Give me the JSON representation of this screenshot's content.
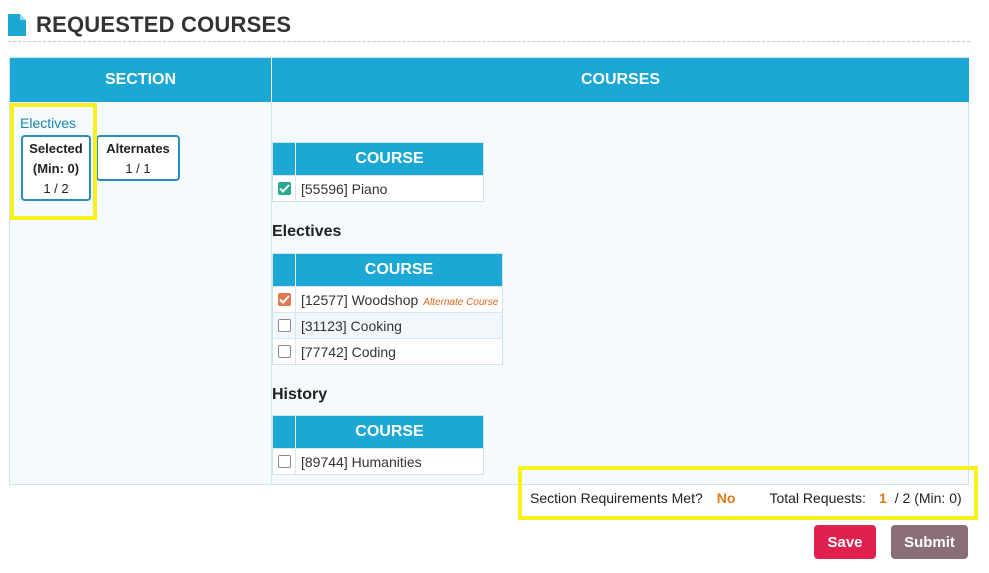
{
  "page": {
    "title": "REQUESTED COURSES"
  },
  "table": {
    "section_header": "SECTION",
    "courses_header": "COURSES"
  },
  "section_panel": {
    "link": "Electives",
    "selected": {
      "label_line1": "Selected",
      "label_line2": "(Min: 0)",
      "value": "1 / 2"
    },
    "alternates": {
      "label": "Alternates",
      "value": "1 / 1"
    }
  },
  "groups": [
    {
      "title": "",
      "column_header": "COURSE",
      "rows": [
        {
          "name": "[55596] Piano",
          "checked": true,
          "check_color": "#2aa890"
        }
      ]
    },
    {
      "title": "Electives",
      "column_header": "COURSE",
      "rows": [
        {
          "name": "[12577] Woodshop",
          "checked": true,
          "check_color": "#e07a50",
          "tag": "Alternate Course"
        },
        {
          "name": "[31123] Cooking",
          "checked": false
        },
        {
          "name": "[77742] Coding",
          "checked": false
        }
      ]
    },
    {
      "title": "History",
      "column_header": "COURSE",
      "rows": [
        {
          "name": "[89744] Humanities",
          "checked": false
        }
      ]
    }
  ],
  "summary": {
    "requirements_label": "Section Requirements Met?",
    "requirements_value": "No",
    "total_label": "Total Requests:",
    "total_current": "1",
    "total_rest": "/ 2 (Min: 0)"
  },
  "buttons": {
    "save": "Save",
    "submit": "Submit"
  },
  "colors": {
    "accent": "#1ba8d5",
    "save": "#e0204f",
    "submit": "#8a6e76",
    "warning": "#e07a16",
    "highlight": "#f7f21e"
  },
  "icons": {
    "header": "document-icon",
    "check": "check-icon"
  }
}
